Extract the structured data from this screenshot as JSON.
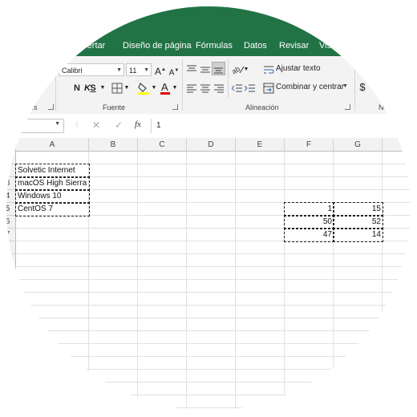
{
  "ribbon_tabs": [
    "Insertar",
    "Diseño de página",
    "Fórmulas",
    "Datos",
    "Revisar",
    "Vista"
  ],
  "font_group": {
    "font_name": "Calibri",
    "font_size": "11",
    "bold": "N",
    "italic": "K",
    "underline": "S",
    "label": "Fuente"
  },
  "clipboard_group": {
    "label": "eles"
  },
  "alignment_group": {
    "wrap_text": "Ajustar texto",
    "merge_center": "Combinar y centrar",
    "label": "Alineación"
  },
  "number_group": {
    "currency_symbol": "$",
    "label": "Nú"
  },
  "formula_bar": {
    "fx": "fx",
    "value": "1"
  },
  "columns": [
    "A",
    "B",
    "C",
    "D",
    "E",
    "F",
    "G"
  ],
  "rows": [
    "1",
    "2",
    "3",
    "4",
    "5",
    "6",
    "7"
  ],
  "text_cells": [
    {
      "row": "2",
      "value": "Solvetic Internet"
    },
    {
      "row": "3",
      "value": "macOS High Sierra"
    },
    {
      "row": "4",
      "value": "Windows 10"
    },
    {
      "row": "5",
      "value": "CentOS 7"
    }
  ],
  "number_cells": [
    {
      "row": "5",
      "F": "1",
      "G": "15"
    },
    {
      "row": "6",
      "F": "50",
      "G": "52"
    },
    {
      "row": "7",
      "F": "47",
      "G": "14"
    }
  ],
  "colors": {
    "excel_green": "#217346",
    "ribbon_bg": "#f3f3f3",
    "highlight_yellow": "#ffff00",
    "font_red": "#e00000"
  }
}
